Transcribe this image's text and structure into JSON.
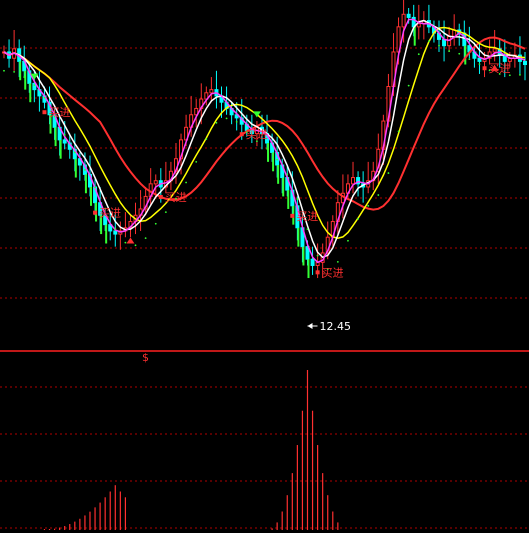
{
  "chart_data": [
    {
      "type": "candlestick",
      "panel": "price",
      "title": "",
      "xlabel": "",
      "ylabel": "",
      "grid": true,
      "low_marker": {
        "label": "12.45",
        "index": 60
      },
      "signal_label": "买进",
      "signals": [
        {
          "index": 8,
          "label": "买进"
        },
        {
          "index": 18,
          "label": "买进"
        },
        {
          "index": 31,
          "label": "买进"
        },
        {
          "index": 47,
          "label": "买进"
        },
        {
          "index": 57,
          "label": "买进"
        },
        {
          "index": 62,
          "label": "买进"
        },
        {
          "index": 95,
          "label": "买进"
        }
      ],
      "up_arrows": [
        25,
        97
      ],
      "down_arrows": [
        6,
        50
      ],
      "ylim": [
        0,
        100
      ],
      "close": [
        86,
        84,
        87,
        83,
        80,
        76,
        74,
        72,
        70,
        66,
        62,
        58,
        57,
        55,
        52,
        50,
        47,
        43,
        38,
        34,
        31,
        29,
        28,
        29,
        30,
        32,
        34,
        36,
        40,
        44,
        45,
        43,
        45,
        48,
        52,
        58,
        62,
        66,
        68,
        71,
        73,
        74,
        72,
        70,
        68,
        66,
        65,
        63,
        61,
        60,
        62,
        60,
        57,
        54,
        50,
        46,
        42,
        37,
        30,
        24,
        20,
        18,
        19,
        22,
        27,
        32,
        38,
        41,
        44,
        46,
        44,
        43,
        45,
        48,
        55,
        64,
        75,
        86,
        94,
        98,
        97,
        94,
        95,
        96,
        94,
        92,
        90,
        88,
        91,
        93,
        92,
        88,
        86,
        84,
        83,
        84,
        86,
        87,
        85,
        83,
        84,
        85,
        83,
        82
      ],
      "ma_series": [
        {
          "color": "#ff3030",
          "period": 20
        },
        {
          "color": "#ffff00",
          "period": 10
        },
        {
          "color": "#ffffff",
          "period": 5
        },
        {
          "color": "#ff40ff",
          "period": 3
        }
      ]
    },
    {
      "type": "bar",
      "panel": "indicator",
      "title": "",
      "xlabel": "",
      "ylabel": "",
      "ylim": [
        0,
        100
      ],
      "marker_label": "$",
      "values": [
        0,
        0,
        0,
        0,
        0,
        0,
        0,
        0,
        0,
        0,
        0,
        0,
        0,
        0,
        0,
        0,
        0,
        0,
        0,
        0,
        0,
        0,
        0,
        0,
        0,
        0,
        0,
        0,
        0,
        0,
        0,
        0,
        0,
        0,
        0,
        0,
        0,
        0,
        0,
        0,
        0,
        0,
        0,
        0,
        0,
        0,
        0,
        0,
        0,
        0,
        0,
        0,
        0,
        0,
        0,
        0,
        0,
        0,
        0,
        0,
        0,
        0,
        0,
        0,
        0,
        0,
        0,
        0,
        0,
        0,
        0,
        0,
        0,
        0,
        0,
        0,
        0,
        0,
        0,
        0,
        0,
        0,
        0,
        0,
        0,
        0,
        0,
        0,
        0,
        0,
        0,
        0,
        0,
        0,
        0,
        0,
        0,
        0,
        0,
        0,
        0,
        0,
        0,
        0
      ],
      "bar_peaks": [
        {
          "from": 8,
          "to": 24,
          "peak": 22,
          "peak_value": 28
        },
        {
          "from": 53,
          "to": 66,
          "peak": 60,
          "peak_value": 100
        }
      ]
    }
  ]
}
